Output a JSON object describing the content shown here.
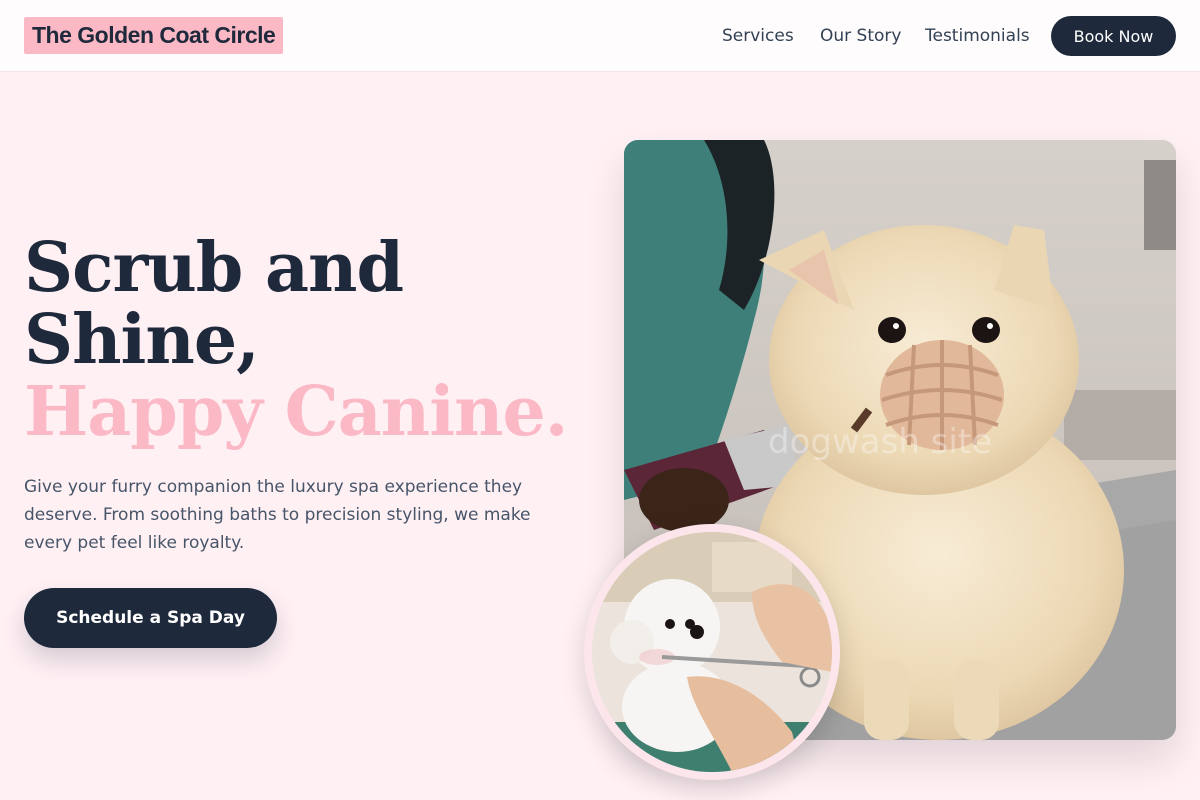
{
  "header": {
    "logo": "The Golden Coat Circle",
    "nav": {
      "services": "Services",
      "story": "Our Story",
      "testimonials": "Testimonials"
    },
    "book_label": "Book Now"
  },
  "hero": {
    "title_line1": "Scrub and",
    "title_line2": "Shine,",
    "title_accent": "Happy Canine.",
    "description": "Give your furry companion the luxury spa experience they deserve. From soothing baths to precision styling, we make every pet feel like royalty.",
    "cta_label": "Schedule a Spa Day"
  },
  "images": {
    "watermark": "dogwash site"
  },
  "colors": {
    "brand_pink": "#fbb9c6",
    "navy": "#1e293b",
    "page_bg": "#fff0f4"
  }
}
